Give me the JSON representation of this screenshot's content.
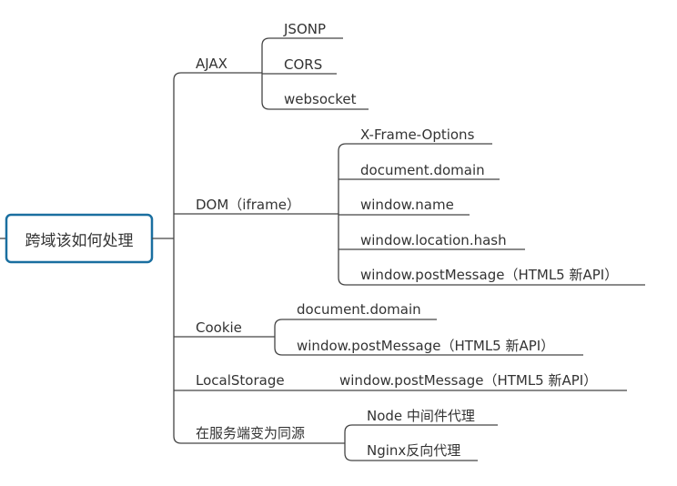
{
  "root": {
    "label": "跨域该如何处理"
  },
  "branches": [
    {
      "label": "AJAX",
      "children": [
        "JSONP",
        "CORS",
        "websocket"
      ]
    },
    {
      "label": "DOM（iframe）",
      "children": [
        "X-Frame-Options",
        "document.domain",
        "window.name",
        "window.location.hash",
        "window.postMessage（HTML5 新API）"
      ]
    },
    {
      "label": "Cookie",
      "children": [
        "document.domain",
        "window.postMessage（HTML5 新API）"
      ]
    },
    {
      "label": "LocalStorage",
      "children": [
        "window.postMessage（HTML5 新API）"
      ]
    },
    {
      "label": "在服务端变为同源",
      "children": [
        "Node 中间件代理",
        "Nginx反向代理"
      ]
    }
  ],
  "colors": {
    "root_border": "#1a6fa0",
    "line": "#444444",
    "text": "#333333"
  }
}
